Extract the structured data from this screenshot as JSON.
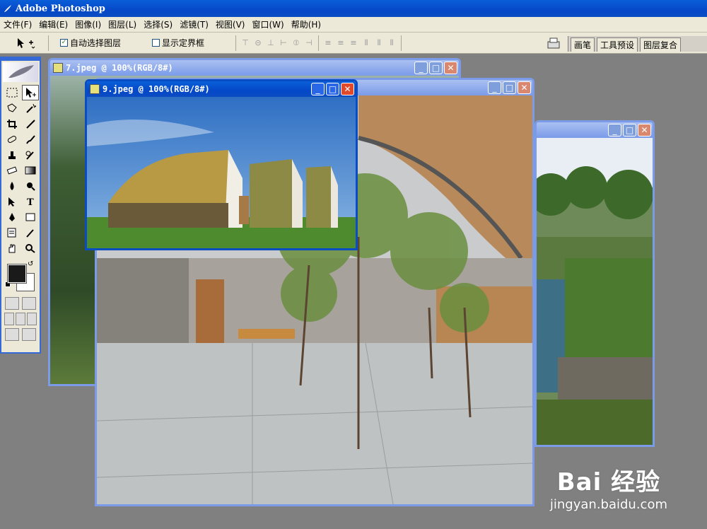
{
  "app": {
    "title": "Adobe Photoshop"
  },
  "menu": [
    "文件(F)",
    "编辑(E)",
    "图像(I)",
    "图层(L)",
    "选择(S)",
    "滤镜(T)",
    "视图(V)",
    "窗口(W)",
    "帮助(H)"
  ],
  "options": {
    "auto_select_label": "自动选择图层",
    "auto_select_checked": true,
    "show_bounds_label": "显示定界框",
    "show_bounds_checked": false
  },
  "palette_well": {
    "tabs": [
      "画笔",
      "工具预设",
      "图层复合"
    ]
  },
  "docs": {
    "doc7": {
      "title": "7.jpeg @ 100%(RGB/8#)"
    },
    "doc9": {
      "title": "9.jpeg @ 100%(RGB/8#)"
    }
  },
  "window_buttons": {
    "minimize": "_",
    "maximize": "□",
    "close": "✕"
  },
  "watermark": {
    "logo": "Bai 经验",
    "url": "jingyan.baidu.com"
  },
  "colors": {
    "title_blue": "#0548c8",
    "foreground": "#1a1a1a",
    "background": "#ffffff"
  }
}
